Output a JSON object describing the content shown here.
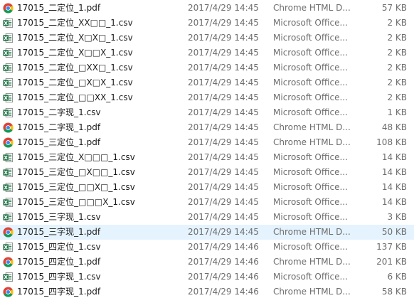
{
  "colors": {
    "chrome_red": "#db4437",
    "chrome_yellow": "#f4c20d",
    "chrome_green": "#0f9d58",
    "chrome_blue": "#4285f4",
    "excel_green": "#217346",
    "selection": "#e5f3ff",
    "meta_text": "#6d6d6d"
  },
  "files": [
    {
      "icon": "chrome-pdf-icon",
      "name": "17015_二定位_1.pdf",
      "date": "2017/4/29 14:45",
      "type": "Chrome HTML D...",
      "size": "57 KB",
      "selected": false
    },
    {
      "icon": "excel-csv-icon",
      "name": "17015_二定位_XX□□_1.csv",
      "date": "2017/4/29 14:45",
      "type": "Microsoft Office...",
      "size": "2 KB",
      "selected": false
    },
    {
      "icon": "excel-csv-icon",
      "name": "17015_二定位_X□X□_1.csv",
      "date": "2017/4/29 14:45",
      "type": "Microsoft Office...",
      "size": "2 KB",
      "selected": false
    },
    {
      "icon": "excel-csv-icon",
      "name": "17015_二定位_X□□X_1.csv",
      "date": "2017/4/29 14:45",
      "type": "Microsoft Office...",
      "size": "2 KB",
      "selected": false
    },
    {
      "icon": "excel-csv-icon",
      "name": "17015_二定位_□XX□_1.csv",
      "date": "2017/4/29 14:45",
      "type": "Microsoft Office...",
      "size": "2 KB",
      "selected": false
    },
    {
      "icon": "excel-csv-icon",
      "name": "17015_二定位_□X□X_1.csv",
      "date": "2017/4/29 14:45",
      "type": "Microsoft Office...",
      "size": "2 KB",
      "selected": false
    },
    {
      "icon": "excel-csv-icon",
      "name": "17015_二定位_□□XX_1.csv",
      "date": "2017/4/29 14:45",
      "type": "Microsoft Office...",
      "size": "2 KB",
      "selected": false
    },
    {
      "icon": "excel-csv-icon",
      "name": "17015_二字现_1.csv",
      "date": "2017/4/29 14:45",
      "type": "Microsoft Office...",
      "size": "1 KB",
      "selected": false
    },
    {
      "icon": "chrome-pdf-icon",
      "name": "17015_二字现_1.pdf",
      "date": "2017/4/29 14:45",
      "type": "Chrome HTML D...",
      "size": "48 KB",
      "selected": false
    },
    {
      "icon": "chrome-pdf-icon",
      "name": "17015_三定位_1.pdf",
      "date": "2017/4/29 14:45",
      "type": "Chrome HTML D...",
      "size": "108 KB",
      "selected": false
    },
    {
      "icon": "excel-csv-icon",
      "name": "17015_三定位_X□□□_1.csv",
      "date": "2017/4/29 14:45",
      "type": "Microsoft Office...",
      "size": "14 KB",
      "selected": false
    },
    {
      "icon": "excel-csv-icon",
      "name": "17015_三定位_□X□□_1.csv",
      "date": "2017/4/29 14:45",
      "type": "Microsoft Office...",
      "size": "14 KB",
      "selected": false
    },
    {
      "icon": "excel-csv-icon",
      "name": "17015_三定位_□□X□_1.csv",
      "date": "2017/4/29 14:45",
      "type": "Microsoft Office...",
      "size": "14 KB",
      "selected": false
    },
    {
      "icon": "excel-csv-icon",
      "name": "17015_三定位_□□□X_1.csv",
      "date": "2017/4/29 14:45",
      "type": "Microsoft Office...",
      "size": "14 KB",
      "selected": false
    },
    {
      "icon": "excel-csv-icon",
      "name": "17015_三字现_1.csv",
      "date": "2017/4/29 14:45",
      "type": "Microsoft Office...",
      "size": "3 KB",
      "selected": false
    },
    {
      "icon": "chrome-pdf-icon",
      "name": "17015_三字现_1.pdf",
      "date": "2017/4/29 14:45",
      "type": "Chrome HTML D...",
      "size": "50 KB",
      "selected": true
    },
    {
      "icon": "excel-csv-icon",
      "name": "17015_四定位_1.csv",
      "date": "2017/4/29 14:46",
      "type": "Microsoft Office...",
      "size": "137 KB",
      "selected": false
    },
    {
      "icon": "chrome-pdf-icon",
      "name": "17015_四定位_1.pdf",
      "date": "2017/4/29 14:46",
      "type": "Chrome HTML D...",
      "size": "201 KB",
      "selected": false
    },
    {
      "icon": "excel-csv-icon",
      "name": "17015_四字现_1.csv",
      "date": "2017/4/29 14:46",
      "type": "Microsoft Office...",
      "size": "6 KB",
      "selected": false
    },
    {
      "icon": "chrome-pdf-icon",
      "name": "17015_四字现_1.pdf",
      "date": "2017/4/29 14:46",
      "type": "Chrome HTML D...",
      "size": "58 KB",
      "selected": false
    }
  ]
}
